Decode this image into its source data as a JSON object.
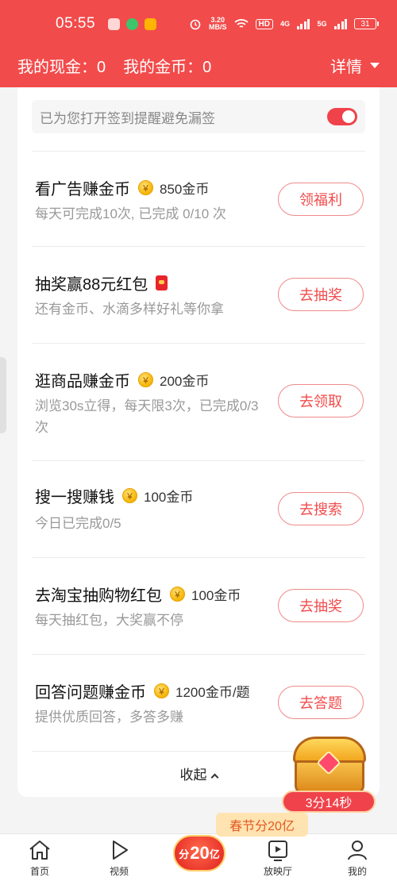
{
  "status_bar": {
    "time": "05:55",
    "net_speed_value": "3.20",
    "net_speed_unit": "MB/S",
    "hd_label": "HD",
    "network_4g": "4G",
    "network_5g": "5G",
    "battery": "31"
  },
  "header": {
    "cash_label": "我的现金：0",
    "coins_label": "我的金币：0",
    "detail_label": "详情"
  },
  "reminder": {
    "text": "已为您打开签到提醒避免漏签",
    "enabled": true
  },
  "tasks": [
    {
      "title": "看广告赚金币",
      "reward": "850金币",
      "desc": "每天可完成10次, 已完成 0/10 次",
      "button": "领福利"
    },
    {
      "title": "抽奖赢88元红包",
      "reward": "",
      "desc": "还有金币、水滴多样好礼等你拿",
      "button": "去抽奖"
    },
    {
      "title": "逛商品赚金币",
      "reward": "200金币",
      "desc": "浏览30s立得，每天限3次，已完成0/3次",
      "button": "去领取"
    },
    {
      "title": "搜一搜赚钱",
      "reward": "100金币",
      "desc": "今日已完成0/5",
      "button": "去搜索"
    },
    {
      "title": "去淘宝抽购物红包",
      "reward": "100金币",
      "desc": "每天抽红包，大奖赢不停",
      "button": "去抽奖"
    },
    {
      "title": "回答问题赚金币",
      "reward": "1200金币/题",
      "desc": "提供优质回答，多答多赚",
      "button": "去答题"
    }
  ],
  "collapse_label": "收起",
  "chest": {
    "timer": "3分14秒"
  },
  "promo": {
    "tag": "春节分20亿",
    "badge_prefix": "分",
    "badge_amount": "20",
    "badge_suffix": "亿"
  },
  "nav": [
    {
      "label": "首页",
      "icon": "home-icon"
    },
    {
      "label": "视频",
      "icon": "play-icon"
    },
    {
      "label": "",
      "icon": "promo-icon"
    },
    {
      "label": "放映厅",
      "icon": "screen-icon"
    },
    {
      "label": "我的",
      "icon": "person-icon"
    }
  ],
  "colors": {
    "brand": "#f24b4b",
    "accent_coin": "#f5b400"
  }
}
